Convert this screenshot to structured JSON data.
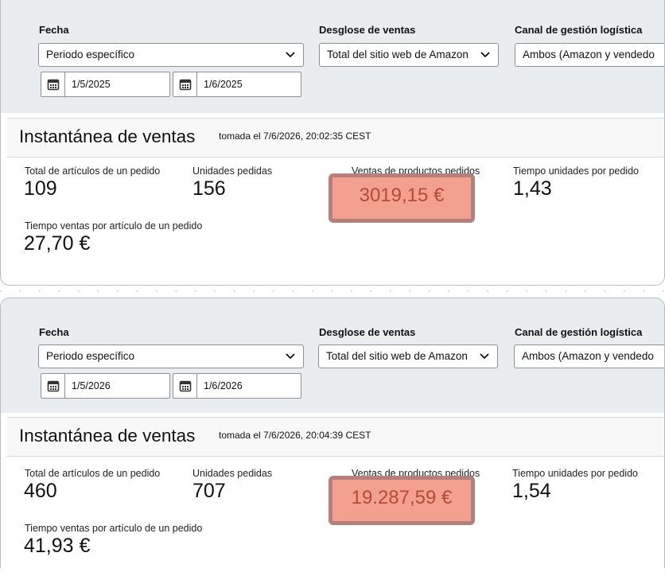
{
  "colors": {
    "filter_bg": "#eaedef",
    "snapshot_header_bg": "#f8f8f8",
    "highlight_fill": "#f4a08f",
    "highlight_border": "#b4807b",
    "highlight_text": "#b34a3a"
  },
  "panels": [
    {
      "filters": {
        "fecha_label": "Fecha",
        "fecha_value": "Periodo específico",
        "start_date": "1/5/2025",
        "end_date": "1/6/2025",
        "desglose_label": "Desglose de ventas",
        "desglose_value": "Total del sitio web de Amazon",
        "canal_label": "Canal de gestión logística",
        "canal_value": "Ambos (Amazon y vendedo"
      },
      "snapshot": {
        "title": "Instantánea de ventas",
        "timestamp": "tomada el 7/6/2026, 20:02:35 CEST"
      },
      "metrics": {
        "total_items_label": "Total de artículos de un pedido",
        "total_items_value": "109",
        "units_label": "Unidades pedidas",
        "units_value": "156",
        "sales_label": "Ventas de productos pedidos",
        "sales_value": "3019,15 €",
        "units_per_order_label": "Tiempo unidades por pedido",
        "units_per_order_value": "1,43",
        "sales_per_item_label": "Tiempo ventas por artículo de un pedido",
        "sales_per_item_value": "27,70 €"
      }
    },
    {
      "filters": {
        "fecha_label": "Fecha",
        "fecha_value": "Periodo específico",
        "start_date": "1/5/2026",
        "end_date": "1/6/2026",
        "desglose_label": "Desglose de ventas",
        "desglose_value": "Total del sitio web de Amazon",
        "canal_label": "Canal de gestión logística",
        "canal_value": "Ambos (Amazon y vendedo"
      },
      "snapshot": {
        "title": "Instantánea de ventas",
        "timestamp": "tomada el 7/6/2026, 20:04:39 CEST"
      },
      "metrics": {
        "total_items_label": "Total de artículos de un pedido",
        "total_items_value": "460",
        "units_label": "Unidades pedidas",
        "units_value": "707",
        "sales_label": "Ventas de productos pedidos",
        "sales_value": "19.287,59 €",
        "units_per_order_label": "Tiempo unidades por pedido",
        "units_per_order_value": "1,54",
        "sales_per_item_label": "Tiempo ventas por artículo de un pedido",
        "sales_per_item_value": "41,93 €"
      }
    }
  ]
}
